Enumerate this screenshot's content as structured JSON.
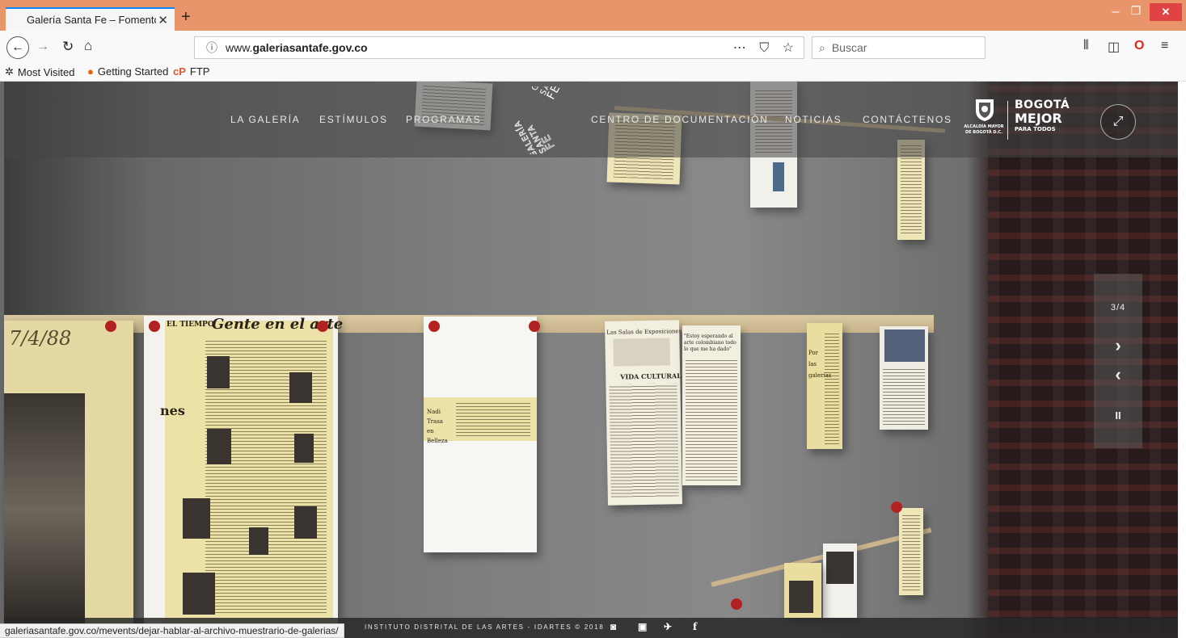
{
  "browser": {
    "tab_title": "Galería Santa Fe – Fomento al",
    "tab_close": "✕",
    "new_tab": "+",
    "url": "www.galeriasantafe.gov.co",
    "url_prefix": "www.",
    "url_domain": "galeriasantafe.gov.co",
    "search_placeholder": "Buscar",
    "bookmarks": [
      {
        "label": "Most Visited",
        "icon": "gear-icon"
      },
      {
        "label": "Getting Started",
        "icon": "firefox-icon"
      },
      {
        "label": "FTP",
        "icon": "ftp-icon"
      }
    ],
    "status_link": "galeriasantafe.gov.co/mevents/dejar-hablar-al-archivo-muestrario-de-galerias/"
  },
  "site": {
    "menu": [
      "LA GALERÍA",
      "ESTÍMULOS",
      "PROGRAMAS",
      "CENTRO DE DOCUMENTACIÓN",
      "NOTICIAS",
      "CONTÁCTENOS"
    ],
    "logo_lines": [
      "GALERÍA",
      "SANTA",
      "FE"
    ],
    "alcaldia_lines": [
      "ALCALDÍA MAYOR",
      "DE BOGOTÁ D.C."
    ],
    "bogota_lines": [
      "BOGOTÁ",
      "MEJOR",
      "PARA TODOS"
    ],
    "slider": {
      "counter": "3/4",
      "next": "›",
      "prev": "‹",
      "pause": "II"
    },
    "footer_text": "INSTITUTO DISTRITAL DE LAS ARTES - IDARTES © 2018",
    "photo_text": {
      "handwritten_date": "7/4/88",
      "newspaper_title": "EL TIEMPO",
      "headline": "Gente en el arte",
      "side_word": "nes",
      "clip_words": "Nadi Trasa en Belleza",
      "vida_cultural": "VIDA CULTURAL",
      "salas": "Las Salas de Exposiciones y sus Directores",
      "quote": "\"Estoy esperando al arte colombiano todo lo que me ha dado\"",
      "por_las_galerias": "Por las galerías"
    }
  },
  "colors": {
    "titlebar": "#E8956B",
    "accent": "#0a84ff",
    "close_button": "#e04343",
    "pin_red": "#b22222",
    "newsprint": "#ece2a8"
  }
}
